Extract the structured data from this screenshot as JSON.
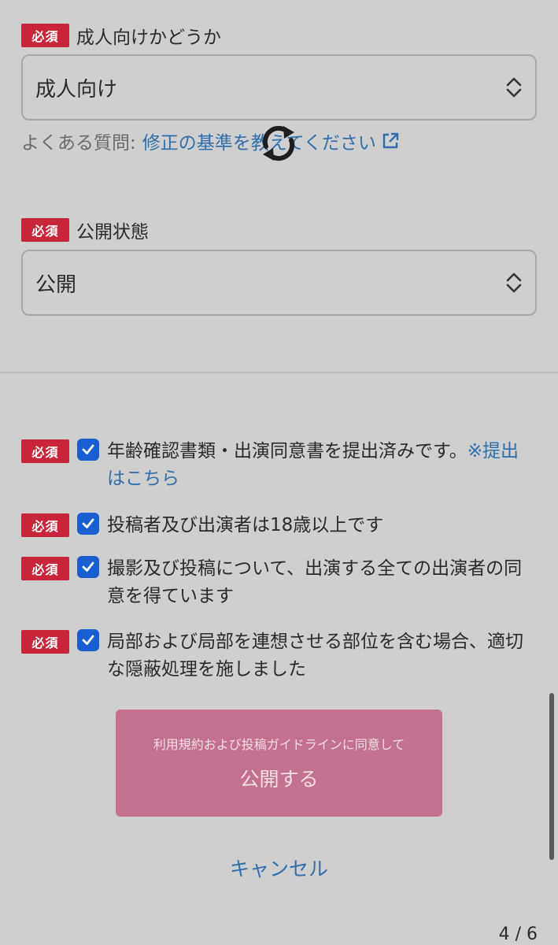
{
  "required_badge": "必須",
  "adult_field": {
    "label": "成人向けかどうか",
    "value": "成人向け",
    "faq_prefix": "よくある質問:",
    "faq_link": "修正の基準を教えてください"
  },
  "visibility_field": {
    "label": "公開状態",
    "value": "公開"
  },
  "checks": [
    {
      "text": "年齢確認書類・出演同意書を提出済みです。",
      "link": "※提出はこちら",
      "checked": true
    },
    {
      "text": "投稿者及び出演者は18歳以上です",
      "checked": true
    },
    {
      "text": "撮影及び投稿について、出演する全ての出演者の同意を得ています",
      "checked": true
    },
    {
      "text": "局部および局部を連想させる部位を含む場合、適切な隠蔽処理を施しました",
      "checked": true
    }
  ],
  "publish_button": {
    "sub_label": "利用規約および投稿ガイドラインに同意して",
    "label": "公開する"
  },
  "cancel_label": "キャンセル",
  "pager": "4 / 6",
  "colors": {
    "badge": "#c8253a",
    "link": "#2f6fad",
    "checkbox": "#1a5fd1",
    "publish_button": "#c47090"
  }
}
